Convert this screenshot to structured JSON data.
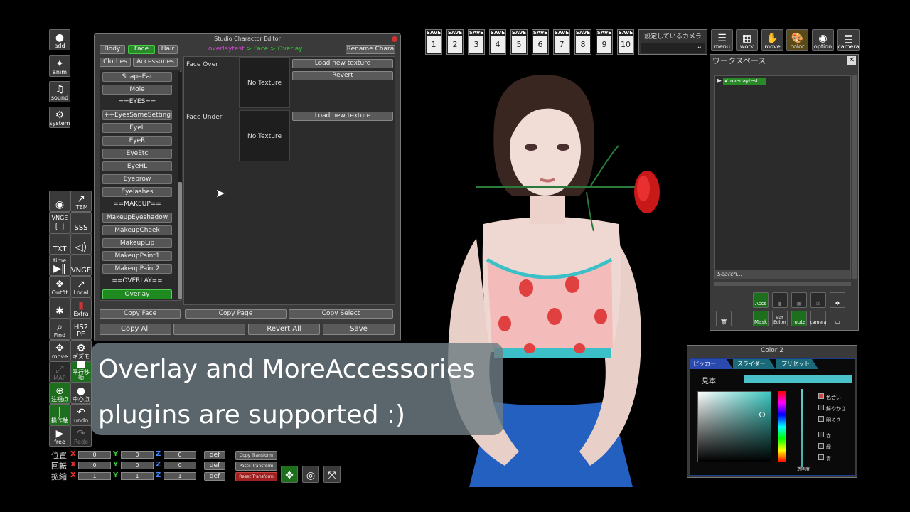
{
  "left_tools": {
    "add": "add",
    "anim": "anim",
    "sound": "sound",
    "system": "system",
    "item": "ITEM",
    "vnge": "VNGE",
    "sss": "SSS",
    "txt": "TXT",
    "time": "time",
    "vnge2": "VNGE",
    "outfit": "Outfit",
    "local": "Local",
    "extra": "Extra",
    "find": "Find",
    "hs2pe": "HS2 PE",
    "move": "move",
    "giz": "ギズモ",
    "map": "MAP",
    "par": "平行移動",
    "cen": "注視点",
    "cen2": "中心点",
    "op": "操作軸",
    "undo": "undo",
    "free": "free",
    "redo": "Redo"
  },
  "editor": {
    "title": "Studio Charactor Editor",
    "tabs": [
      "Body",
      "Face",
      "Hair"
    ],
    "breadcrumb_name": "overlaytest",
    "breadcrumb_path": " > Face > Overlay",
    "rename": "Rename Chara",
    "subtabs": [
      "Clothes",
      "Accessories"
    ],
    "list": [
      "ShapeEar",
      "Mole",
      "==EYES==",
      "++EyesSameSetting",
      "EyeL",
      "EyeR",
      "EyeEtc",
      "EyeHL",
      "Eyebrow",
      "Eyelashes",
      "==MAKEUP==",
      "MakeupEyeshadow",
      "MakeupCheek",
      "MakeupLip",
      "MakeupPaint1",
      "MakeupPaint2",
      "==OVERLAY==",
      "Overlay"
    ],
    "face_over": "Face Over",
    "face_under": "Face Under",
    "no_texture": "No Texture",
    "load_texture": "Load new texture",
    "revert": "Revert",
    "copy_face": "Copy Face",
    "copy_page": "Copy Page",
    "copy_select": "Copy Select",
    "copy_all": "Copy All",
    "revert_all": "Revert All",
    "save": "Save"
  },
  "savebar": {
    "label": "SAVE",
    "slots": [
      "1",
      "2",
      "3",
      "4",
      "5",
      "6",
      "7",
      "8",
      "9",
      "10"
    ],
    "camera_select": "設定しているカメラ"
  },
  "topright": {
    "menu": "menu",
    "work": "work",
    "move": "move",
    "color": "color",
    "option": "option",
    "camera": "camera"
  },
  "workspace": {
    "title": "ワークスペース",
    "item": "overlaytest",
    "search": "Search...",
    "buttons": {
      "accs": "Accs",
      "mask": "Mask",
      "mat": "Mat. Editor",
      "route": "route",
      "camera": "camera"
    }
  },
  "color": {
    "title": "Color 2",
    "tabs": [
      "ピッカー",
      "スライダー",
      "プリセット"
    ],
    "sample": "見本",
    "opacity": "透明度",
    "opts": [
      "色合い",
      "鮮やかさ",
      "明るさ",
      "赤",
      "緑",
      "青"
    ]
  },
  "transform": {
    "rows": [
      {
        "label": "位置",
        "x": "0",
        "y": "0",
        "z": "0"
      },
      {
        "label": "回転",
        "x": "0",
        "y": "0",
        "z": "0"
      },
      {
        "label": "拡縮",
        "x": "1",
        "y": "1",
        "z": "1"
      }
    ],
    "def": "def",
    "copy": "Copy Transform",
    "paste": "Paste Transform",
    "reset": "Reset Transform"
  },
  "caption": {
    "line1": "Overlay and MoreAccessories",
    "line2": "plugins are supported :)"
  }
}
